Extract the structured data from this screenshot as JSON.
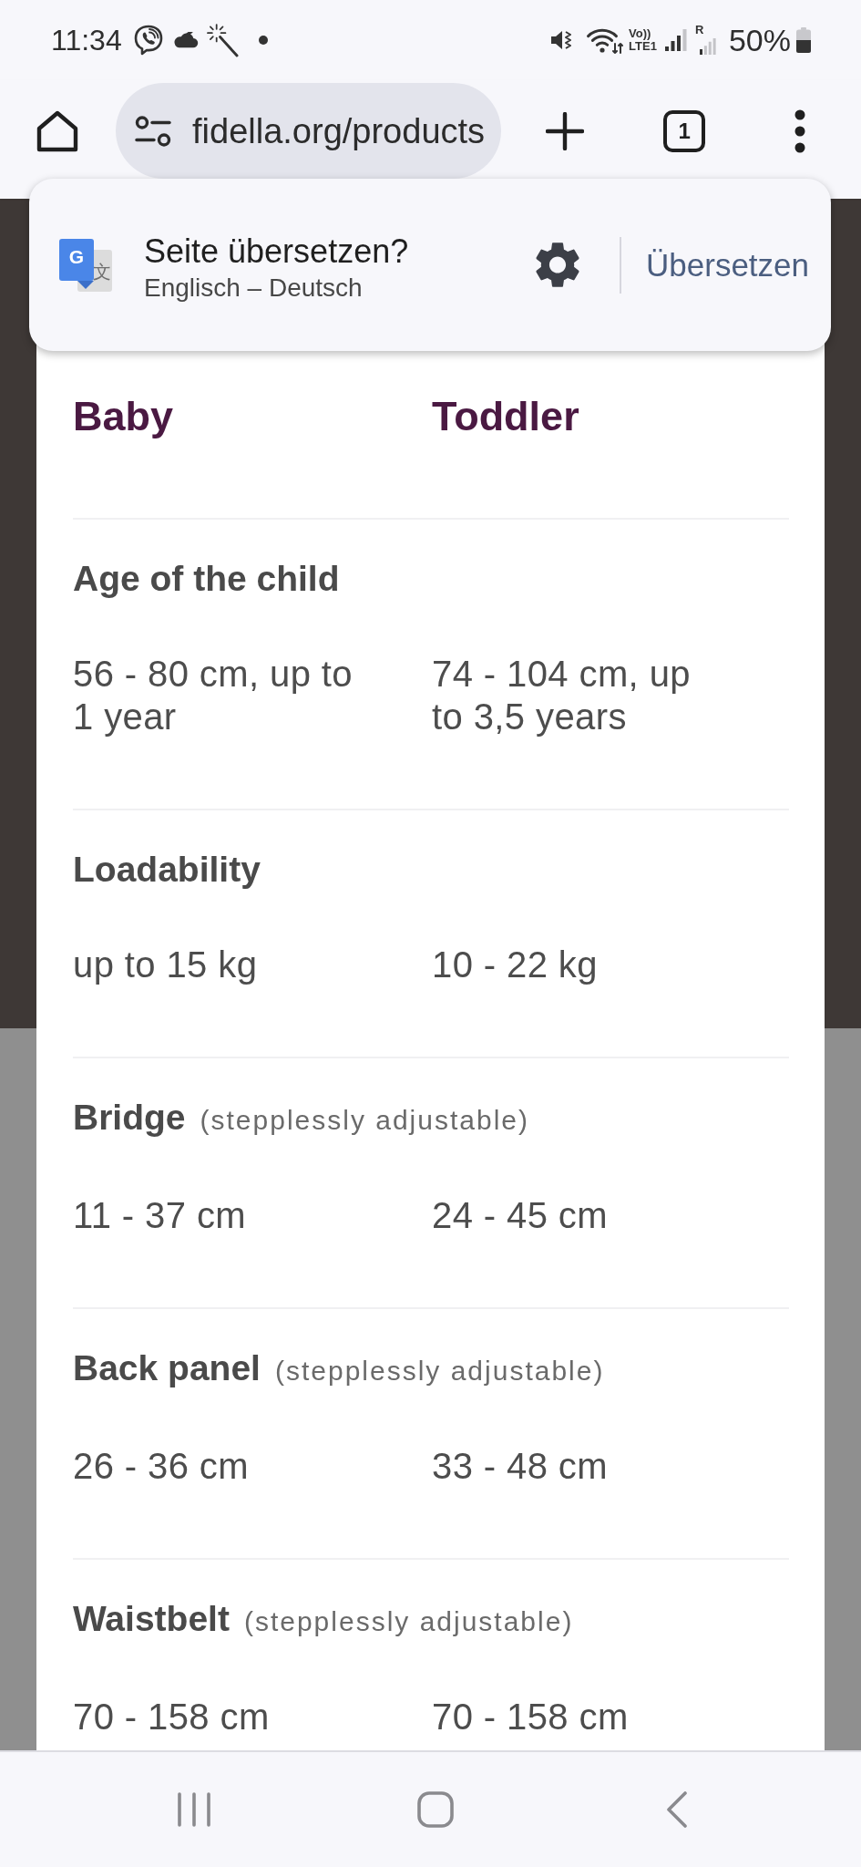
{
  "status_bar": {
    "time": "11:34",
    "network_top": "Vo))",
    "network_bottom": "LTE1",
    "roaming": "R",
    "battery": "50%"
  },
  "browser_toolbar": {
    "url": "fidella.org/products",
    "tab_count": "1"
  },
  "translate_popup": {
    "icon_letter": "G",
    "icon_glyph": "文",
    "title": "Seite übersetzen?",
    "languages": "Englisch – Deutsch",
    "action": "Übersetzen"
  },
  "table": {
    "columns": [
      "Baby",
      "Toddler"
    ],
    "rows": [
      {
        "label": "Age of the child",
        "values": [
          "56 - 80 cm, up to 1 year",
          "74 - 104 cm, up to 3,5 years"
        ]
      },
      {
        "label": "Loadability",
        "values": [
          "up to 15 kg",
          "10 - 22 kg"
        ]
      },
      {
        "label": "Bridge",
        "note": "(stepplessly adjustable)",
        "values": [
          "11 - 37 cm",
          "24 - 45 cm"
        ]
      },
      {
        "label": "Back panel",
        "note": "(stepplessly adjustable)",
        "values": [
          "26 - 36 cm",
          "33 - 48 cm"
        ]
      },
      {
        "label": "Waistbelt",
        "note": "(stepplessly adjustable)",
        "values": [
          "70 - 158 cm",
          "70 - 158 cm"
        ]
      }
    ]
  }
}
